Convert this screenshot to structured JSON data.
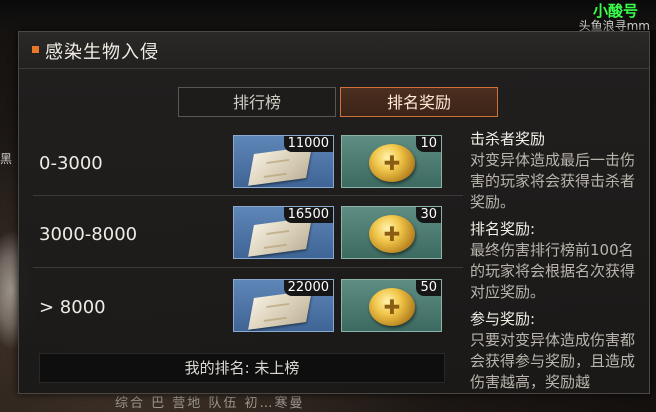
{
  "background": {
    "player_name": "小酸号",
    "player_sub": "头鱼浪寻mm",
    "left_char": "黑",
    "bottom_bar": "综合  巴  营地  队伍  初…寒曼"
  },
  "panel": {
    "title": "感染生物入侵",
    "tabs": [
      {
        "label": "排行榜",
        "active": false
      },
      {
        "label": "排名奖励",
        "active": true
      }
    ],
    "rows": [
      {
        "range": "0-3000",
        "ticket_count": "11000",
        "coin_count": "10"
      },
      {
        "range": "3000-8000",
        "ticket_count": "16500",
        "coin_count": "30"
      },
      {
        "range": "> 8000",
        "ticket_count": "22000",
        "coin_count": "50"
      }
    ],
    "my_rank": "我的排名: 未上榜",
    "description": [
      {
        "heading": "击杀者奖励",
        "text": "对变异体造成最后一击伤害的玩家将会获得击杀者奖励。"
      },
      {
        "heading": "排名奖励:",
        "text": "最终伤害排行榜前100名的玩家将会根据名次获得对应奖励。"
      },
      {
        "heading": "参与奖励:",
        "text": "只要对变异体造成伤害都会获得参与奖励，且造成伤害越高，奖励越"
      }
    ]
  },
  "colors": {
    "accent": "#e9772a",
    "ticket_bg": "#4a72a4",
    "coin_bg": "#4c7b71",
    "player_name": "#39ff4a"
  },
  "icons": {
    "ticket": "ticket-icon",
    "coin": "gold-coin-icon"
  }
}
